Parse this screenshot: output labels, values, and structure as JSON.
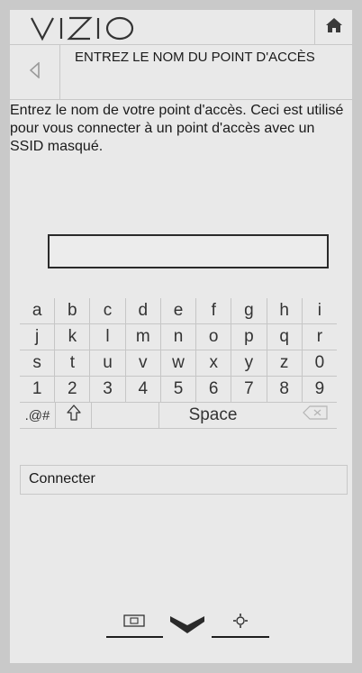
{
  "header": {
    "logo_text": "VIZIO",
    "home_icon": "home-icon"
  },
  "title_row": {
    "back_icon": "back-arrow-icon",
    "title": "ENTREZ LE NOM DU POINT D'ACCÈS"
  },
  "description": "Entrez le nom de votre point d'accès. Ceci est utilisé pour vous connecter à un point d'accès avec un SSID masqué.",
  "text_input": {
    "value": ""
  },
  "keyboard": {
    "row1": [
      "a",
      "b",
      "c",
      "d",
      "e",
      "f",
      "g",
      "h",
      "i"
    ],
    "row2": [
      "j",
      "k",
      "l",
      "m",
      "n",
      "o",
      "p",
      "q",
      "r"
    ],
    "row3": [
      "s",
      "t",
      "u",
      "v",
      "w",
      "x",
      "y",
      "z",
      "0"
    ],
    "row4": [
      "1",
      "2",
      "3",
      "4",
      "5",
      "6",
      "7",
      "8",
      "9"
    ],
    "symbols_label": ".@#",
    "shift_icon": "shift-icon",
    "space_label": "Space",
    "delete_icon": "backspace-icon"
  },
  "connect_label": "Connecter",
  "footer": {
    "icons": [
      "input-icon",
      "menu-chevron-icon",
      "settings-icon"
    ]
  },
  "colors": {
    "background": "#c9c9c9",
    "panel": "#e9e9e9",
    "text": "#1a1a1a",
    "divider": "#c8c8c8"
  }
}
